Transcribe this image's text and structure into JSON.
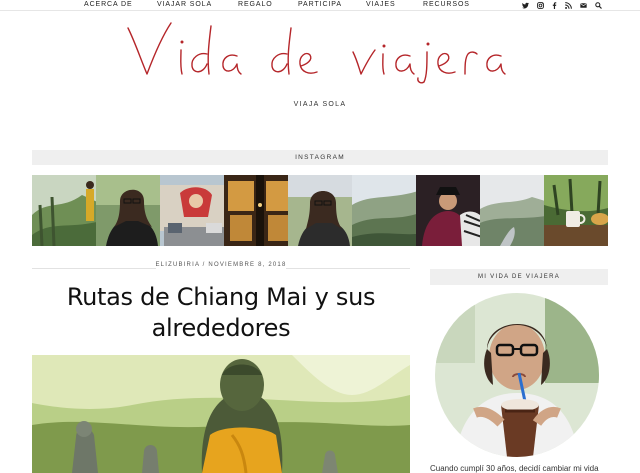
{
  "nav": {
    "items": [
      "ACERCA DE",
      "VIAJAR SOLA",
      "REGALO",
      "PARTICIPA",
      "VIAJES",
      "RECURSOS"
    ],
    "social_icons": [
      "twitter-icon",
      "instagram-icon",
      "facebook-icon",
      "rss-icon",
      "email-icon",
      "search-icon"
    ]
  },
  "header": {
    "logo_text": "Vida de viajera",
    "tagline": "VIAJA SOLA",
    "logo_color": "#b5262a"
  },
  "instagram": {
    "label": "INSTAGRAM",
    "thumb_count": 8
  },
  "post": {
    "meta": "ELIZUBIRIA / NOVIEMBRE 8, 2018",
    "title_line1": "Rutas de Chiang Mai y sus",
    "title_line2": "alrededores"
  },
  "sidebar": {
    "title": "MI VIDA DE VIAJERA",
    "intro_partial": "Cuando cumplí 30 años, decidí cambiar mi vida"
  }
}
